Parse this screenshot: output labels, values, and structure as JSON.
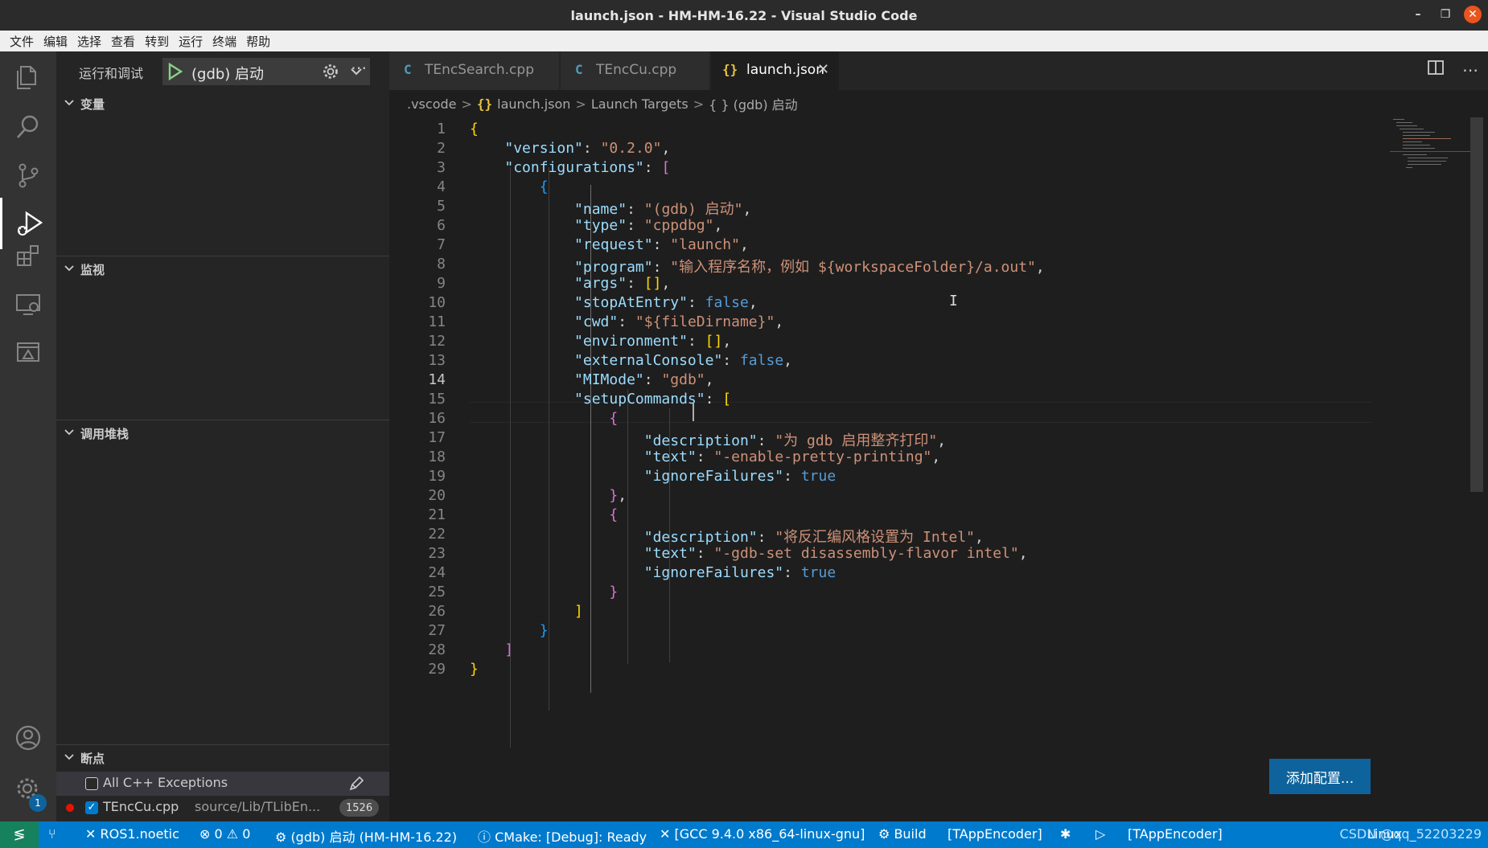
{
  "window": {
    "title": "launch.json - HM-HM-16.22 - Visual Studio Code"
  },
  "menu": [
    "文件",
    "编辑",
    "选择",
    "查看",
    "转到",
    "运行",
    "终端",
    "帮助"
  ],
  "activity": {
    "settings_badge": "1"
  },
  "sidebar": {
    "title": "运行和调试",
    "config_name": "(gdb) 启动",
    "sections": {
      "variables": "变量",
      "watch": "监视",
      "callstack": "调用堆栈",
      "breakpoints": "断点"
    },
    "breakpoints": {
      "all_cpp_exceptions": "All C++ Exceptions",
      "file": "TEncCu.cpp",
      "path": "source/Lib/TLibEn...",
      "line": "1526"
    }
  },
  "tabs": [
    {
      "label": "TEncSearch.cpp",
      "icon": "C"
    },
    {
      "label": "TEncCu.cpp",
      "icon": "C"
    },
    {
      "label": "launch.json",
      "icon": "{}"
    }
  ],
  "breadcrumb": {
    "folder": ".vscode",
    "file_icon": "{}",
    "file": "launch.json",
    "section": "Launch Targets",
    "item": "{ } (gdb) 启动"
  },
  "editor": {
    "line_numbers": [
      "1",
      "2",
      "3",
      "4",
      "5",
      "6",
      "7",
      "8",
      "9",
      "10",
      "11",
      "12",
      "13",
      "14",
      "15",
      "16",
      "17",
      "18",
      "19",
      "20",
      "21",
      "22",
      "23",
      "24",
      "25",
      "26",
      "27",
      "28",
      "29"
    ],
    "current_line": "14",
    "strings": {
      "version_key": "\"version\"",
      "version_val": "\"0.2.0\"",
      "configurations_key": "\"configurations\"",
      "name_key": "\"name\"",
      "name_val": "\"(gdb) 启动\"",
      "type_key": "\"type\"",
      "type_val": "\"cppdbg\"",
      "request_key": "\"request\"",
      "request_val": "\"launch\"",
      "program_key": "\"program\"",
      "program_val": "\"输入程序名称，例如 ${workspaceFolder}/a.out\"",
      "args_key": "\"args\"",
      "stopAtEntry_key": "\"stopAtEntry\"",
      "false": "false",
      "true": "true",
      "cwd_key": "\"cwd\"",
      "cwd_val": "\"${fileDirname}\"",
      "environment_key": "\"environment\"",
      "externalConsole_key": "\"externalConsole\"",
      "MIMode_key": "\"MIMode\"",
      "MIMode_val": "\"gdb\"",
      "setupCommands_key": "\"setupCommands\"",
      "description_key": "\"description\"",
      "desc1_val": "\"为 gdb 启用整齐打印\"",
      "text_key": "\"text\"",
      "text1_val": "\"-enable-pretty-printing\"",
      "ignoreFailures_key": "\"ignoreFailures\"",
      "desc2_val": "\"将反汇编风格设置为 Intel\"",
      "text2_val": "\"-gdb-set disassembly-flavor intel\""
    }
  },
  "add_config_button": "添加配置...",
  "status": {
    "ros": "ROS1.noetic",
    "errors": "0",
    "warnings": "0",
    "debug": "(gdb) 启动 (HM-HM-16.22)",
    "cmake": "CMake: [Debug]: Ready",
    "kit": "[GCC 9.4.0 x86_64-linux-gnu]",
    "build": "Build",
    "target1": "[TAppEncoder]",
    "target2": "[TAppEncoder]",
    "right": "Linux"
  },
  "watermark": "CSDN @qq_52203229",
  "colors": {
    "accent": "#007acc",
    "remote": "#16825d",
    "key": "#9cdcfe",
    "string": "#ce9178",
    "keyword": "#569cd6"
  }
}
